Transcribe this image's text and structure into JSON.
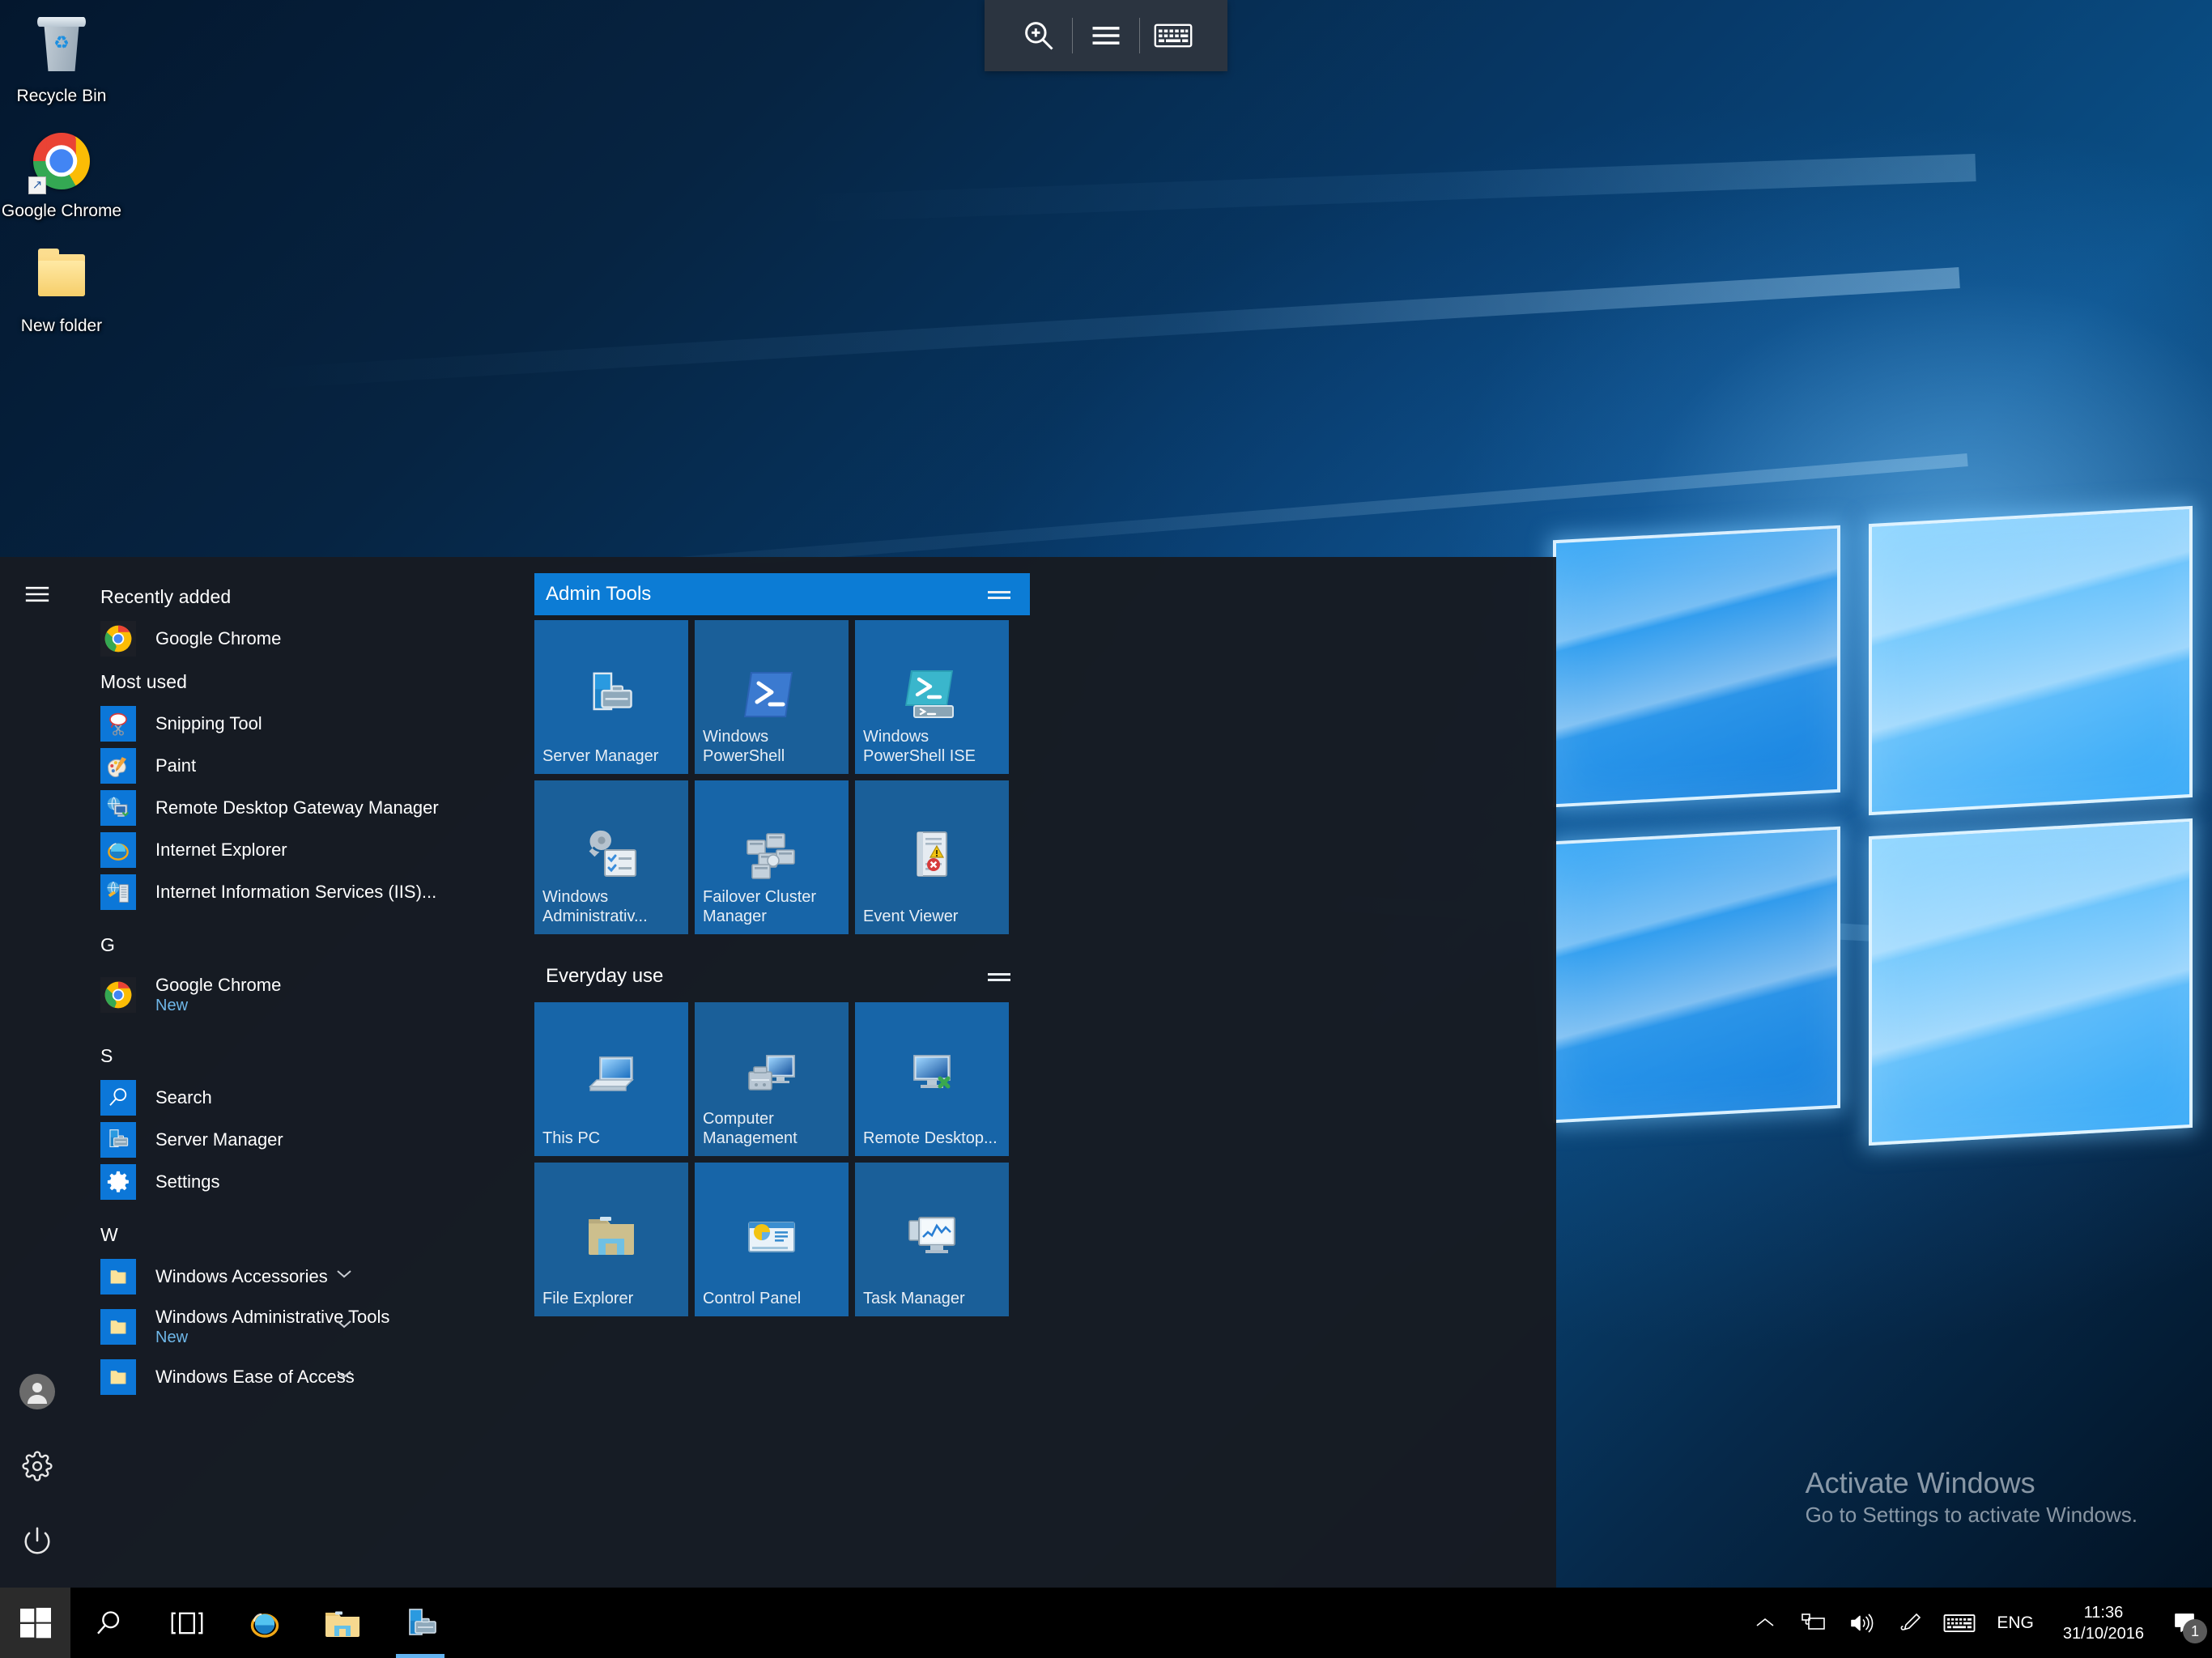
{
  "desktop": {
    "icons": [
      {
        "label": "Recycle Bin",
        "icon": "recycle-bin-icon"
      },
      {
        "label": "Google Chrome",
        "icon": "chrome-icon"
      },
      {
        "label": "New folder",
        "icon": "folder-icon"
      }
    ],
    "watermark": {
      "title": "Activate Windows",
      "subtitle": "Go to Settings to activate Windows."
    }
  },
  "top_toolbar": {
    "buttons": [
      {
        "icon": "zoom-in-icon",
        "name": "zoom-in-button"
      },
      {
        "icon": "hamburger-menu-icon",
        "name": "menu-button"
      },
      {
        "icon": "keyboard-icon",
        "name": "keyboard-button"
      }
    ]
  },
  "start_menu": {
    "rail": {
      "hamburger": "hamburger-menu-icon",
      "user": "user-account-icon",
      "settings": "gear-icon",
      "power": "power-icon"
    },
    "sections": [
      {
        "heading": "Recently added",
        "items": [
          {
            "label": "Google Chrome",
            "sub": "",
            "icon": "chrome-icon",
            "chevron": false
          }
        ]
      },
      {
        "heading": "Most used",
        "items": [
          {
            "label": "Snipping Tool",
            "sub": "",
            "icon": "snipping-tool-icon",
            "chevron": false
          },
          {
            "label": "Paint",
            "sub": "",
            "icon": "paint-icon",
            "chevron": false
          },
          {
            "label": "Remote Desktop Gateway Manager",
            "sub": "",
            "icon": "remote-desktop-gateway-icon",
            "chevron": false
          },
          {
            "label": "Internet Explorer",
            "sub": "",
            "icon": "internet-explorer-icon",
            "chevron": false
          },
          {
            "label": "Internet Information Services (IIS)...",
            "sub": "",
            "icon": "iis-manager-icon",
            "chevron": false
          }
        ]
      },
      {
        "heading": "G",
        "items": [
          {
            "label": "Google Chrome",
            "sub": "New",
            "icon": "chrome-icon",
            "chevron": false
          }
        ]
      },
      {
        "heading": "S",
        "items": [
          {
            "label": "Search",
            "sub": "",
            "icon": "search-icon",
            "chevron": false
          },
          {
            "label": "Server Manager",
            "sub": "",
            "icon": "server-manager-icon",
            "chevron": false
          },
          {
            "label": "Settings",
            "sub": "",
            "icon": "gear-icon",
            "chevron": false
          }
        ]
      },
      {
        "heading": "W",
        "items": [
          {
            "label": "Windows Accessories",
            "sub": "",
            "icon": "folder-icon",
            "chevron": true
          },
          {
            "label": "Windows Administrative Tools",
            "sub": "New",
            "icon": "folder-icon",
            "chevron": true
          },
          {
            "label": "Windows Ease of Access",
            "sub": "",
            "icon": "folder-icon",
            "chevron": true
          }
        ]
      }
    ],
    "tile_groups": [
      {
        "title": "Admin Tools",
        "selected": true,
        "tiles": [
          {
            "label": "Server Manager",
            "icon": "server-manager-icon"
          },
          {
            "label": "Windows PowerShell",
            "icon": "powershell-icon"
          },
          {
            "label": "Windows PowerShell ISE",
            "icon": "powershell-ise-icon"
          },
          {
            "label": "Windows Administrativ...",
            "icon": "windows-administrative-tools-icon"
          },
          {
            "label": "Failover Cluster Manager",
            "icon": "failover-cluster-icon"
          },
          {
            "label": "Event Viewer",
            "icon": "event-viewer-icon"
          }
        ]
      },
      {
        "title": "Everyday use",
        "selected": false,
        "tiles": [
          {
            "label": "This PC",
            "icon": "this-pc-icon"
          },
          {
            "label": "Computer Management",
            "icon": "computer-management-icon"
          },
          {
            "label": "Remote Desktop...",
            "icon": "remote-desktop-icon"
          },
          {
            "label": "File Explorer",
            "icon": "file-explorer-icon"
          },
          {
            "label": "Control Panel",
            "icon": "control-panel-icon"
          },
          {
            "label": "Task Manager",
            "icon": "task-manager-icon"
          }
        ]
      }
    ]
  },
  "taskbar": {
    "start_icon": "windows-logo-icon",
    "items": [
      {
        "icon": "search-icon",
        "name": "taskbar-search",
        "active": false
      },
      {
        "icon": "task-view-icon",
        "name": "taskbar-task-view",
        "active": false
      },
      {
        "icon": "internet-explorer-icon",
        "name": "taskbar-internet-explorer",
        "active": false
      },
      {
        "icon": "file-explorer-icon",
        "name": "taskbar-file-explorer",
        "active": false
      },
      {
        "icon": "server-manager-icon",
        "name": "taskbar-server-manager",
        "active": true
      }
    ],
    "tray": {
      "show_hidden": "chevron-up-icon",
      "network": "network-icon",
      "volume": "speaker-icon",
      "pen": "pen-icon",
      "keyboard": "keyboard-icon",
      "language": "ENG",
      "time": "11:36",
      "date": "31/10/2016",
      "action_center_icon": "action-center-icon",
      "notification_count": "1"
    }
  },
  "colors": {
    "accent": "#0c7cd5",
    "tile": "#1765a8",
    "menu_bg": "#171b22",
    "taskbar_bg": "#000000",
    "link": "#6fb7e8"
  }
}
